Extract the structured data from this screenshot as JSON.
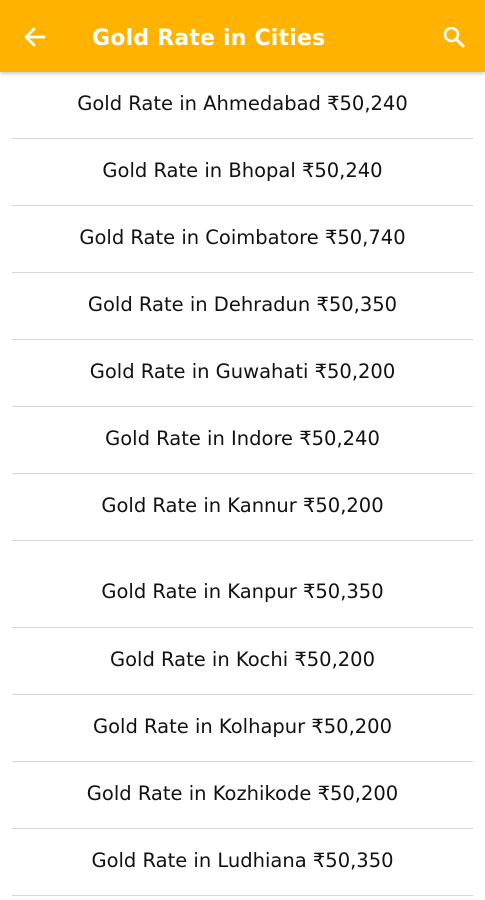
{
  "header": {
    "title": "Gold Rate in Cities",
    "back_icon": "arrow-left-icon",
    "search_icon": "search-icon",
    "background_color": "#ffb300"
  },
  "cities": [
    {
      "label": "Gold Rate in Ahmedabad ₹50,240"
    },
    {
      "label": "Gold Rate in Bhopal ₹50,240"
    },
    {
      "label": "Gold Rate in Coimbatore ₹50,740"
    },
    {
      "label": "Gold Rate in Dehradun ₹50,350"
    },
    {
      "label": "Gold Rate in Guwahati ₹50,200"
    },
    {
      "label": "Gold Rate in Indore ₹50,240"
    },
    {
      "label": "Gold Rate in Kannur ₹50,200"
    },
    {
      "label": "Gold Rate in Kanpur ₹50,350"
    },
    {
      "label": "Gold Rate in Kochi ₹50,200"
    },
    {
      "label": "Gold Rate in Kolhapur ₹50,200"
    },
    {
      "label": "Gold Rate in Kozhikode ₹50,200"
    },
    {
      "label": "Gold Rate in Ludhiana ₹50,350"
    }
  ]
}
